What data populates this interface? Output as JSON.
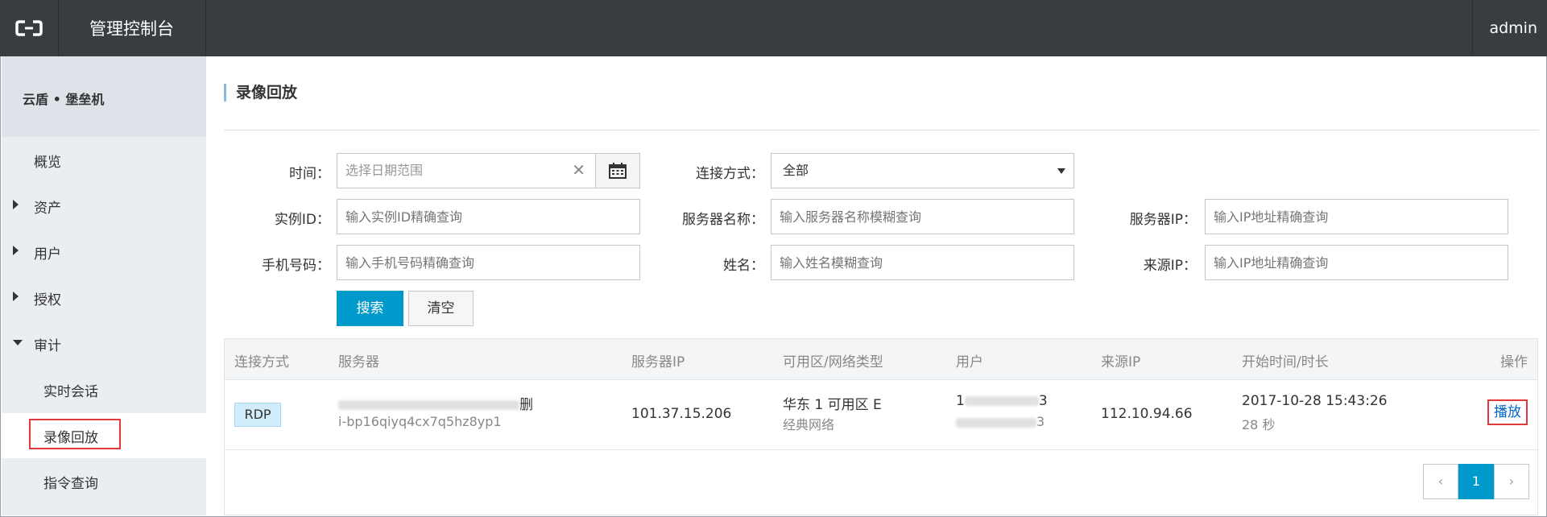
{
  "header": {
    "title": "管理控制台",
    "user": "admin"
  },
  "sidebar": {
    "product": "云盾 • 堡垒机",
    "items": [
      {
        "label": "概览"
      },
      {
        "label": "资产"
      },
      {
        "label": "用户"
      },
      {
        "label": "授权"
      },
      {
        "label": "审计"
      }
    ],
    "audit_sub": [
      {
        "label": "实时会话"
      },
      {
        "label": "录像回放"
      },
      {
        "label": "指令查询"
      }
    ]
  },
  "page": {
    "title": "录像回放"
  },
  "filters": {
    "time": {
      "label": "时间：",
      "placeholder": "选择日期范围"
    },
    "conn_type": {
      "label": "连接方式：",
      "value": "全部"
    },
    "instance_id": {
      "label": "实例ID：",
      "placeholder": "输入实例ID精确查询"
    },
    "server_name": {
      "label": "服务器名称：",
      "placeholder": "输入服务器名称模糊查询"
    },
    "server_ip": {
      "label": "服务器IP：",
      "placeholder": "输入IP地址精确查询"
    },
    "phone": {
      "label": "手机号码：",
      "placeholder": "输入手机号码精确查询"
    },
    "name": {
      "label": "姓名：",
      "placeholder": "输入姓名模糊查询"
    },
    "source_ip": {
      "label": "来源IP：",
      "placeholder": "输入IP地址精确查询"
    },
    "search_btn": "搜索",
    "clear_btn": "清空"
  },
  "table": {
    "columns": [
      "连接方式",
      "服务器",
      "服务器IP",
      "可用区/网络类型",
      "用户",
      "来源IP",
      "开始时间/时长",
      "操作"
    ],
    "rows": [
      {
        "conn": "RDP",
        "server_name_tail": "删",
        "instance": "i-bp16qiyq4cx7q5hz8yp1",
        "server_ip": "101.37.15.206",
        "zone": "华东 1 可用区 E",
        "network": "经典网络",
        "user_line1_head": "1",
        "user_line1_tail": "3",
        "user_line2_tail": "3",
        "source_ip": "112.10.94.66",
        "start": "2017-10-28 15:43:26",
        "duration": "28 秒",
        "action": "播放"
      }
    ]
  },
  "pagination": {
    "prev": "‹",
    "current": "1",
    "next": "›"
  }
}
